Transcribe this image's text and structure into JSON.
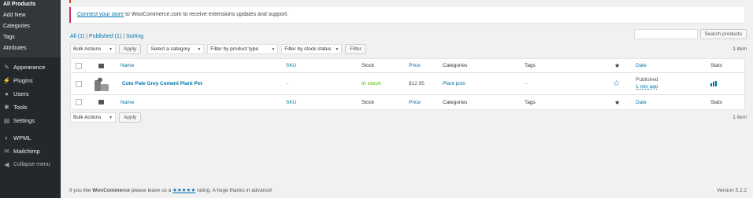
{
  "sidebar": {
    "submenu": [
      {
        "label": "All Products",
        "current": true
      },
      {
        "label": "Add New"
      },
      {
        "label": "Categories"
      },
      {
        "label": "Tags"
      },
      {
        "label": "Attributes"
      }
    ],
    "menu": [
      {
        "label": "Appearance",
        "icon": "paintbrush-icon",
        "glyph": "✎"
      },
      {
        "label": "Plugins",
        "icon": "plugin-icon",
        "glyph": "⚡"
      },
      {
        "label": "Users",
        "icon": "users-icon",
        "glyph": "👤"
      },
      {
        "label": "Tools",
        "icon": "wrench-icon",
        "glyph": "🔧"
      },
      {
        "label": "Settings",
        "icon": "settings-icon",
        "glyph": "▤"
      },
      {
        "label": "WPML",
        "icon": "wpml-icon",
        "glyph": "◐"
      },
      {
        "label": "Mailchimp",
        "icon": "mailchimp-icon",
        "glyph": "✉"
      }
    ],
    "collapse_label": "Collapse menu"
  },
  "notice": {
    "link_text": "Connect your store",
    "text": " to WooCommerce.com to receive extensions updates and support."
  },
  "views": {
    "all": "All",
    "all_count": "(1)",
    "sep1": " | ",
    "published": "Published",
    "published_count": "(1)",
    "sep2": " | ",
    "sorting": "Sorting"
  },
  "search": {
    "button": "Search products",
    "value": ""
  },
  "filters": {
    "bulk_actions": "Bulk Actions",
    "apply": "Apply",
    "category": "Select a category",
    "product_type": "Filter by product type",
    "stock_status": "Filter by stock status",
    "filter": "Filter"
  },
  "item_count": "1 item",
  "table": {
    "columns": {
      "name": "Name",
      "sku": "SKU",
      "stock": "Stock",
      "price": "Price",
      "categories": "Categories",
      "tags": "Tags",
      "date": "Date",
      "stats": "Stats"
    },
    "rows": [
      {
        "name": "Cute Pale Grey Cement Plant Pot",
        "sku": "–",
        "stock": "In stock",
        "price": "$12.95",
        "categories": "Plant pots",
        "tags": "–",
        "status": "Published",
        "date": "1 min ago"
      }
    ]
  },
  "bottom_nav": {
    "bulk_actions": "Bulk Actions",
    "apply": "Apply"
  },
  "footer": {
    "prefix": "If you like ",
    "brand": "WooCommerce",
    "middle": " please leave us a ",
    "stars": "★★★★★",
    "suffix": " rating. A huge thanks in advance!",
    "version": "Version 5.2.2"
  },
  "colors": {
    "accent": "#0073aa",
    "instock": "#7ad03a",
    "sidebar": "#23282d",
    "notice_border": "#c9356e"
  }
}
